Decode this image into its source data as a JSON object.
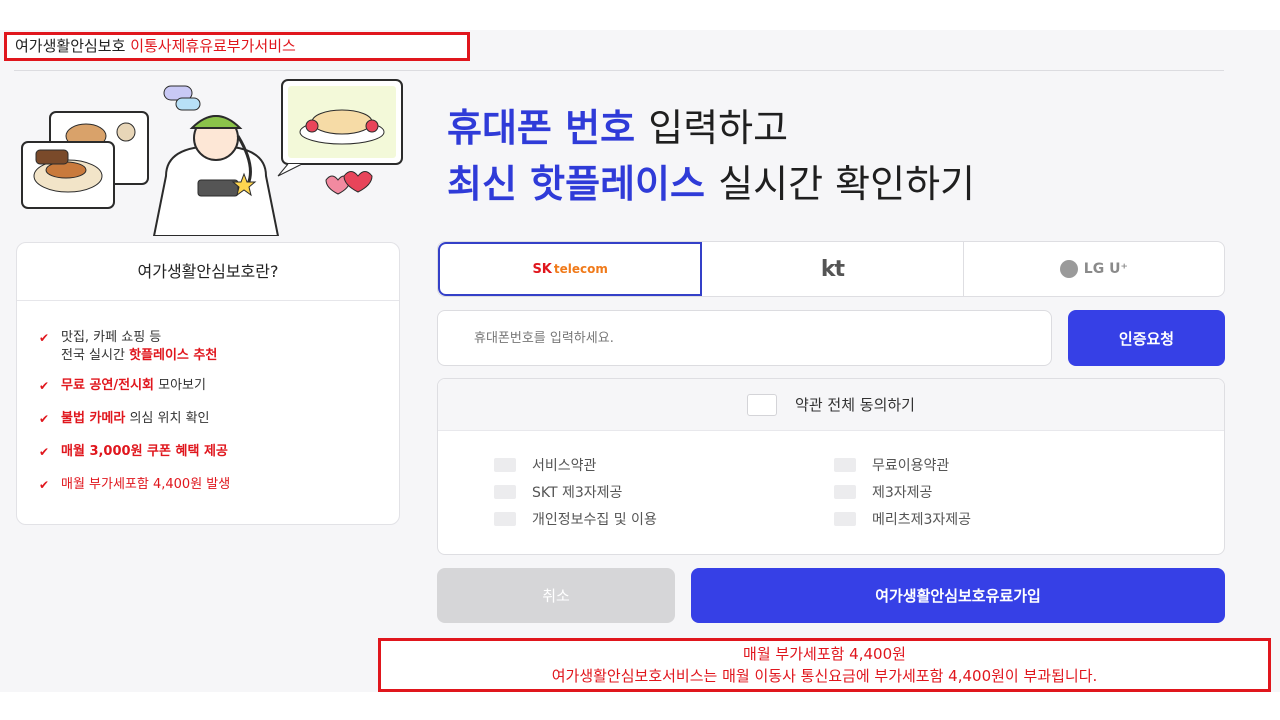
{
  "top_label": {
    "part1": "여가생활안심보호",
    "part2": "이통사제휴유료부가서비스"
  },
  "headline": {
    "line1_blue": "휴대폰 번호",
    "line1_rest": "입력하고",
    "line2_blue": "최신 핫플레이스",
    "line2_rest": "실시간 확인하기"
  },
  "info": {
    "title": "여가생활안심보호란?",
    "item1_line1": "맛집, 카페 쇼핑 등",
    "item1_line2_plain": "전국 실시간",
    "item1_line2_red": "핫플레이스 추천",
    "item2_red": "무료 공연/전시회",
    "item2_plain": "모아보기",
    "item3_red": "불법 카메라",
    "item3_plain": "의심 위치 확인",
    "item4": "매월 3,000원 쿠폰 혜택 제공",
    "item5": "매월 부가세포함 4,400원 발생"
  },
  "carriers": {
    "sk_main": "SK",
    "sk_sub": "telecom",
    "kt": "kt",
    "lg": "LG U⁺"
  },
  "phone": {
    "placeholder": "휴대폰번호를 입력하세요."
  },
  "verify_label": "인증요청",
  "terms": {
    "all": "약관 전체 동의하기",
    "service": "서비스약관",
    "free_use": "무료이용약관",
    "skt_third": "SKT 제3자제공",
    "third": "제3자제공",
    "privacy": "개인정보수집 및 이용",
    "merits_third": "메리츠제3자제공"
  },
  "cancel_label": "취소",
  "join_label": "여가생활안심보호유료가입",
  "notice": {
    "line1": "매월 부가세포함 4,400원",
    "line2": "여가생활안심보호서비스는 매월 이동사 통신요금에 부가세포함 4,400원이 부과됩니다."
  },
  "colors": {
    "accent_blue": "#3640e6",
    "headline_blue": "#2f3bd8",
    "alert_red": "#e0161d"
  }
}
